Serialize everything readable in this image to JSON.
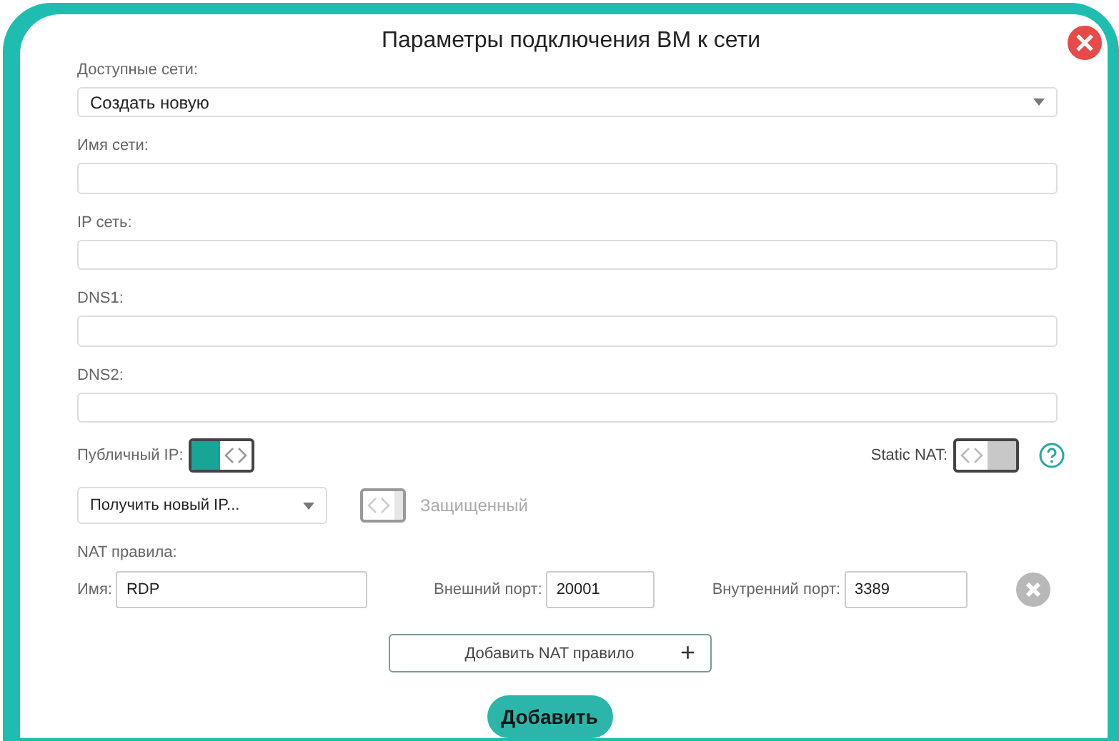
{
  "dialog": {
    "title": "Параметры подключения ВМ к сети"
  },
  "fields": [
    {
      "kind": "select",
      "label": "Доступные сети:",
      "value": "Создать новую"
    },
    {
      "kind": "input",
      "label": "Имя сети:"
    },
    {
      "kind": "input",
      "label": "IP сеть:"
    },
    {
      "kind": "input",
      "label": "DNS1:"
    },
    {
      "kind": "input",
      "label": "DNS2:"
    }
  ],
  "public_ip": {
    "label": "Публичный IP:",
    "on": true
  },
  "static_nat": {
    "label": "Static NAT:",
    "on": false
  },
  "ip_select": {
    "value": "Получить новый IP..."
  },
  "protected": {
    "label": "Защищенный",
    "on": false,
    "disabled": true
  },
  "nat": {
    "title": "NAT правила:",
    "rules": [
      {
        "name_label": "Имя:",
        "name": "RDP",
        "ext_label": "Внешний порт:",
        "ext": "20001",
        "int_label": "Внутренний порт:",
        "int": "3389"
      }
    ],
    "add_label": "Добавить NAT правило",
    "add_icon": "+"
  },
  "submit": "Добавить"
}
